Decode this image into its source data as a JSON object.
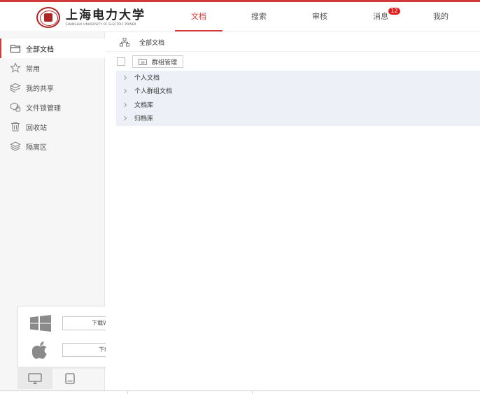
{
  "brand": {
    "name_cn": "上海电力大学",
    "name_en": "SHANGHAI UNIVERSITY OF ELECTRIC POWER",
    "accent": "#d23a3a"
  },
  "nav": {
    "items": [
      {
        "label": "文档",
        "active": true
      },
      {
        "label": "搜索"
      },
      {
        "label": "审核"
      },
      {
        "label": "消息",
        "badge": "12"
      },
      {
        "label": "我的"
      }
    ]
  },
  "sidebar": {
    "items": [
      {
        "label": "全部文档",
        "icon": "folder-icon",
        "active": true
      },
      {
        "label": "常用",
        "icon": "star-icon"
      },
      {
        "label": "我的共享",
        "icon": "share-icon"
      },
      {
        "label": "文件锁管理",
        "icon": "lock-icon"
      },
      {
        "label": "回收站",
        "icon": "trash-icon"
      },
      {
        "label": "隔离区",
        "icon": "layers-icon"
      }
    ]
  },
  "clients": {
    "windows_label": "下载Windows客户端",
    "mac_label": "下载Mac客户端"
  },
  "main": {
    "breadcrumb": "全部文档",
    "toolbar": {
      "group_manage_label": "群组管理"
    },
    "tree": [
      {
        "label": "个人文档"
      },
      {
        "label": "个人群组文档"
      },
      {
        "label": "文档库"
      },
      {
        "label": "归档库"
      }
    ]
  }
}
